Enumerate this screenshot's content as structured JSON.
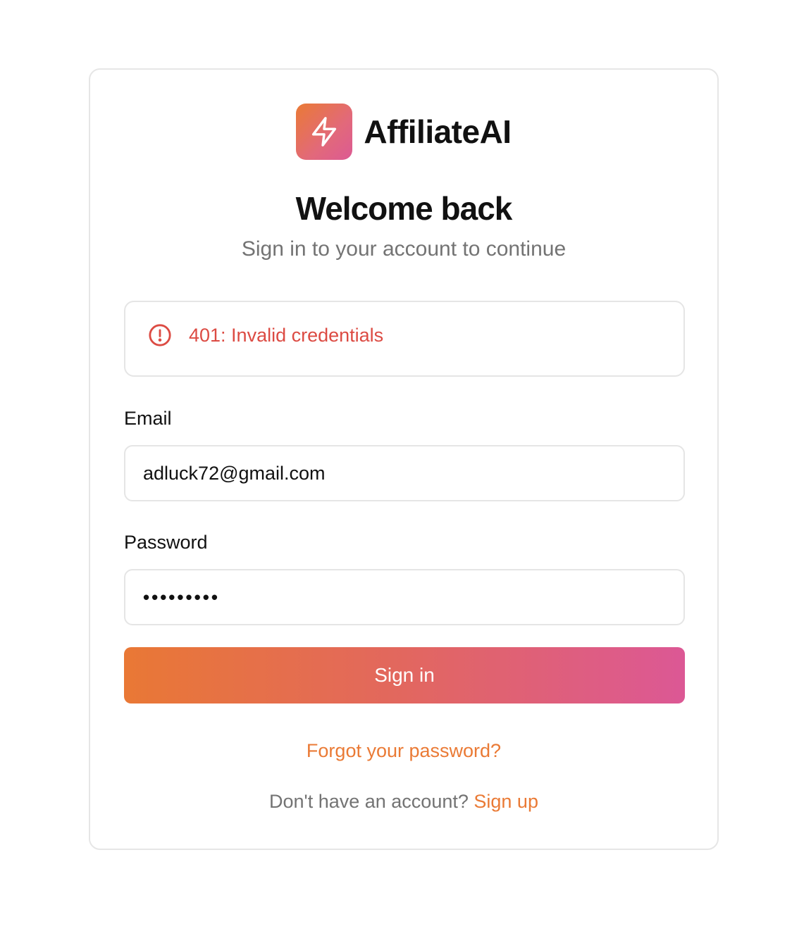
{
  "brand": {
    "name": "AffiliateAI",
    "logo_icon": "lightning-bolt-icon",
    "gradient_start": "#ea7a35",
    "gradient_end": "#dc5a94"
  },
  "header": {
    "title": "Welcome back",
    "subtitle": "Sign in to your account to continue"
  },
  "alert": {
    "icon": "alert-circle-icon",
    "message": "401: Invalid credentials",
    "color": "#dc4b43"
  },
  "form": {
    "email_label": "Email",
    "email_value": "adluck72@gmail.com",
    "password_label": "Password",
    "password_value": "•••••••••",
    "submit_label": "Sign in"
  },
  "links": {
    "forgot_password": "Forgot your password?",
    "no_account_text": "Don't have an account?",
    "sign_up": "Sign up",
    "link_color": "#ea7a35"
  }
}
